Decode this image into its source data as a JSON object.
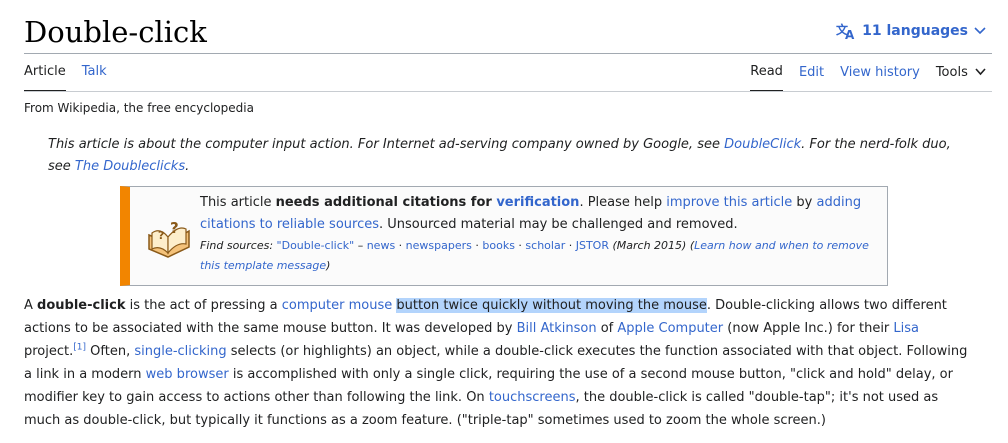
{
  "header": {
    "title": "Double-click",
    "languages_label": "11 languages"
  },
  "tabs_left": [
    {
      "label": "Article"
    },
    {
      "label": "Talk"
    }
  ],
  "tabs_right": [
    {
      "label": "Read"
    },
    {
      "label": "Edit"
    },
    {
      "label": "View history"
    },
    {
      "label": "Tools"
    }
  ],
  "tagline": "From Wikipedia, the free encyclopedia",
  "hatnote": {
    "t1": "This article is about the computer input action. For Internet ad-serving company owned by Google, see ",
    "link1": "DoubleClick",
    "t2": ". For the nerd-folk duo, see ",
    "link2": "The Doubleclicks",
    "t3": "."
  },
  "ambox": {
    "t1": "This article ",
    "bold": "needs additional citations for ",
    "link_verification": "verification",
    "t2": ". Please help ",
    "link_improve": "improve this article",
    "t3": " by ",
    "link_adding": "adding citations to reliable sources",
    "t4": ". Unsourced material may be challenged and removed.",
    "find_label": "Find sources:",
    "find_query": "\"Double-click\"",
    "sep_dash": " – ",
    "src_news": "news",
    "src_newspapers": "newspapers",
    "src_books": "books",
    "src_scholar": "scholar",
    "src_jstor": "JSTOR",
    "sep_dot": " · ",
    "date": " (March 2015)",
    "learn_open": " (",
    "learn_link": "Learn how and when to remove this template message",
    "learn_close": ")"
  },
  "paragraph": {
    "t1": "A ",
    "bold": "double-click",
    "t2": " is the act of pressing a ",
    "link_mouse": "computer mouse",
    "t3": " ",
    "highlight": "button twice quickly without moving the mouse",
    "t4": ". Double-clicking allows two different actions to be associated with the same mouse button. It was developed by ",
    "link_atkinson": "Bill Atkinson",
    "t5": " of ",
    "link_apple": "Apple Computer",
    "t6": " (now Apple Inc.) for their ",
    "link_lisa": "Lisa",
    "t7": " project.",
    "cite": "[1]",
    "t8": " Often, ",
    "link_single": "single-clicking",
    "t9": " selects (or highlights) an object, while a double-click executes the function associated with that object. Following a link in a modern ",
    "link_browser": "web browser",
    "t10": " is accomplished with only a single click, requiring the use of a second mouse button, \"click and hold\" delay, or modifier key to gain access to actions other than following the link. On ",
    "link_touch": "touchscreens",
    "t11": ", the double-click is called \"double-tap\"; it's not used as much as double-click, but typically it functions as a zoom feature. (\"triple-tap\" sometimes used to zoom the whole screen.)"
  },
  "colors": {
    "link": "#3366cc",
    "ambox_accent": "#f28500",
    "selection": "#b3d4fc"
  }
}
